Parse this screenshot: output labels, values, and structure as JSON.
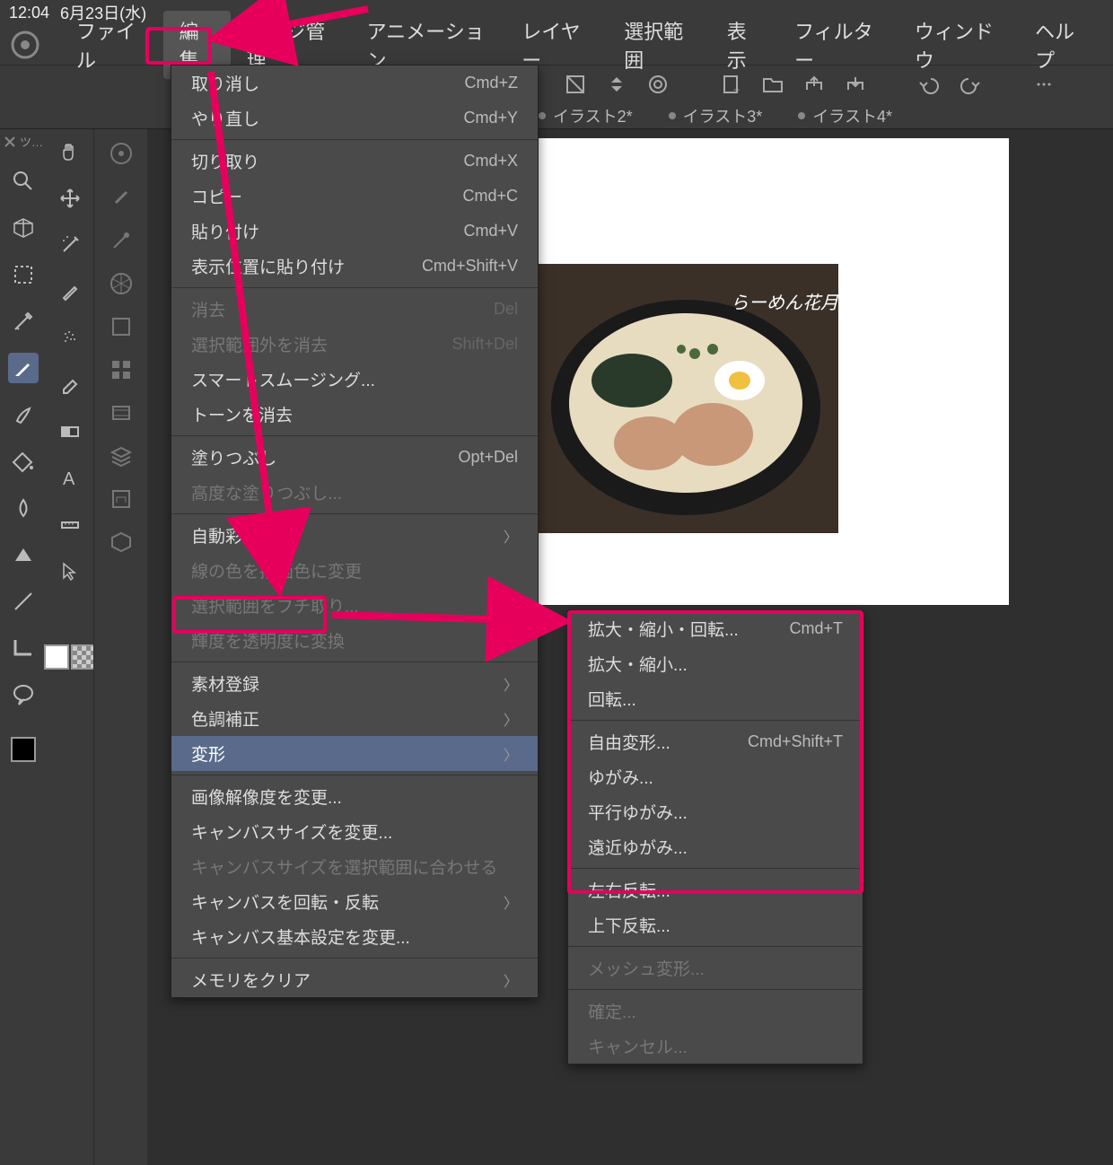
{
  "status": {
    "time": "12:04",
    "date": "6月23日(水)"
  },
  "menubar": [
    "ファイル",
    "編集",
    "ページ管理",
    "アニメーション",
    "レイヤー",
    "選択範囲",
    "表示",
    "フィルター",
    "ウィンドウ",
    "ヘルプ"
  ],
  "tabs": [
    "イラスト2*",
    "イラスト3*",
    "イラスト4*"
  ],
  "tooltip_label": "ツ…",
  "edit_menu": [
    {
      "label": "取り消し",
      "shortcut": "Cmd+Z",
      "type": "item"
    },
    {
      "label": "やり直し",
      "shortcut": "Cmd+Y",
      "type": "item"
    },
    {
      "type": "div"
    },
    {
      "label": "切り取り",
      "shortcut": "Cmd+X",
      "type": "item"
    },
    {
      "label": "コピー",
      "shortcut": "Cmd+C",
      "type": "item"
    },
    {
      "label": "貼り付け",
      "shortcut": "Cmd+V",
      "type": "item"
    },
    {
      "label": "表示位置に貼り付け",
      "shortcut": "Cmd+Shift+V",
      "type": "item"
    },
    {
      "type": "div"
    },
    {
      "label": "消去",
      "shortcut": "Del",
      "type": "item",
      "disabled": true
    },
    {
      "label": "選択範囲外を消去",
      "shortcut": "Shift+Del",
      "type": "item",
      "disabled": true
    },
    {
      "label": "スマートスムージング...",
      "type": "item"
    },
    {
      "label": "トーンを消去",
      "type": "item"
    },
    {
      "type": "div"
    },
    {
      "label": "塗りつぶし",
      "shortcut": "Opt+Del",
      "type": "item"
    },
    {
      "label": "高度な塗りつぶし...",
      "type": "item",
      "disabled": true
    },
    {
      "type": "div"
    },
    {
      "label": "自動彩色",
      "type": "sub"
    },
    {
      "label": "線の色を描画色に変更",
      "type": "item",
      "disabled": true
    },
    {
      "label": "選択範囲をフチ取り...",
      "type": "item",
      "disabled": true
    },
    {
      "label": "輝度を透明度に変換",
      "type": "item",
      "disabled": true
    },
    {
      "type": "div"
    },
    {
      "label": "素材登録",
      "type": "sub"
    },
    {
      "label": "色調補正",
      "type": "sub"
    },
    {
      "label": "変形",
      "type": "sub",
      "highlight": true
    },
    {
      "type": "div"
    },
    {
      "label": "画像解像度を変更...",
      "type": "item"
    },
    {
      "label": "キャンバスサイズを変更...",
      "type": "item"
    },
    {
      "label": "キャンバスサイズを選択範囲に合わせる",
      "type": "item",
      "disabled": true
    },
    {
      "label": "キャンバスを回転・反転",
      "type": "sub"
    },
    {
      "label": "キャンバス基本設定を変更...",
      "type": "item"
    },
    {
      "type": "div"
    },
    {
      "label": "メモリをクリア",
      "type": "sub"
    }
  ],
  "transform_submenu": [
    {
      "label": "拡大・縮小・回転...",
      "shortcut": "Cmd+T"
    },
    {
      "label": "拡大・縮小..."
    },
    {
      "label": "回転..."
    },
    {
      "type": "div"
    },
    {
      "label": "自由変形...",
      "shortcut": "Cmd+Shift+T"
    },
    {
      "label": "ゆがみ..."
    },
    {
      "label": "平行ゆがみ..."
    },
    {
      "label": "遠近ゆがみ..."
    },
    {
      "type": "div"
    },
    {
      "label": "左右反転..."
    },
    {
      "label": "上下反転..."
    },
    {
      "type": "div"
    },
    {
      "label": "メッシュ変形...",
      "disabled": true
    },
    {
      "type": "div"
    },
    {
      "label": "確定...",
      "disabled": true
    },
    {
      "label": "キャンセル...",
      "disabled": true
    }
  ]
}
